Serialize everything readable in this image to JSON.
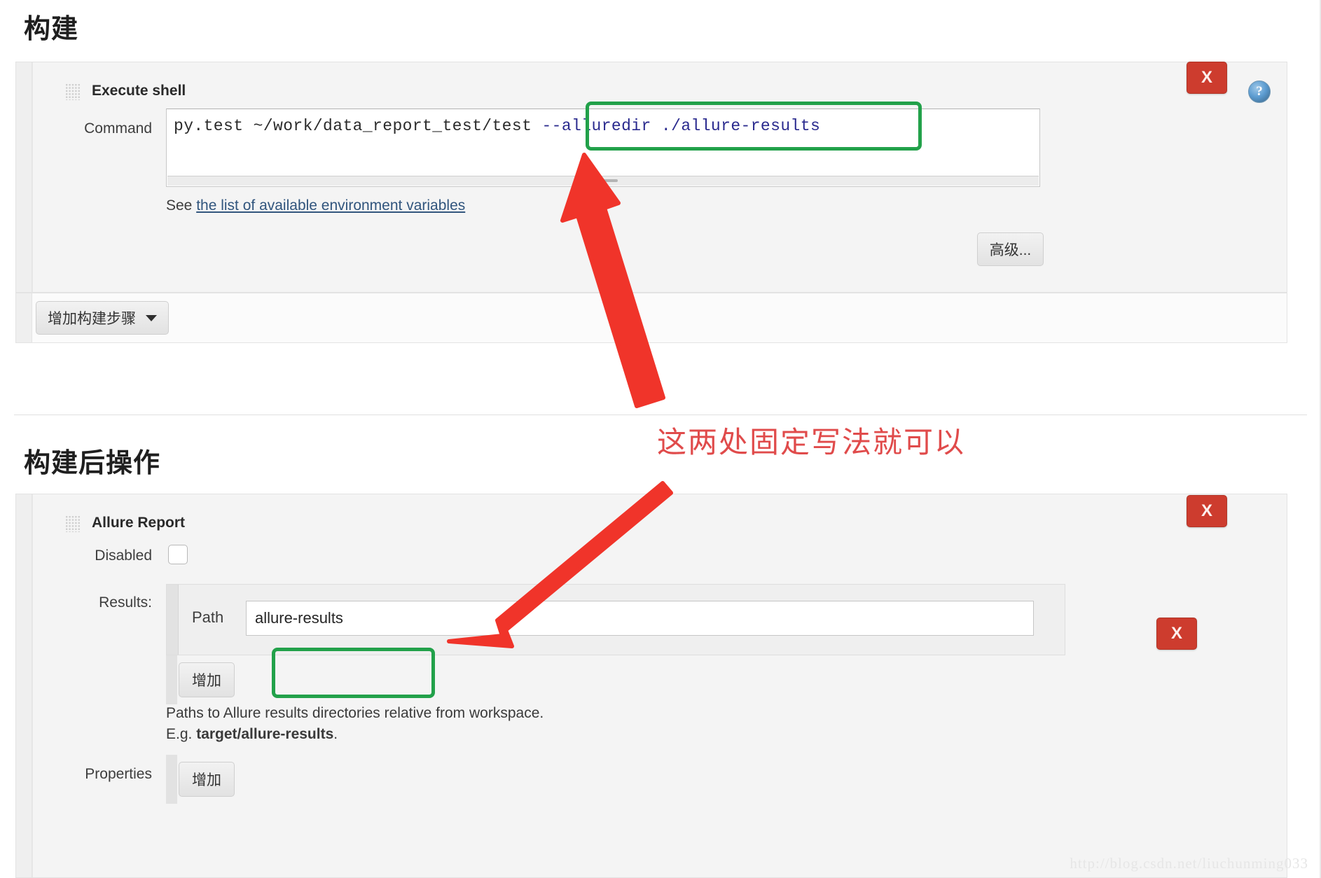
{
  "sections": {
    "build": {
      "heading": "构建"
    },
    "post_build": {
      "heading": "构建后操作"
    }
  },
  "execute_shell": {
    "title": "Execute shell",
    "command_label": "Command",
    "command_prefix": "py.test ~/work/data_report_test/test ",
    "command_highlight": "--alluredir ./allure-results",
    "command_full": "py.test ~/work/data_report_test/test --alluredir ./allure-results",
    "helper_prefix": "See ",
    "helper_link": "the list of available environment variables",
    "advanced_button": "高级...",
    "delete_button": "X",
    "help_icon": "?"
  },
  "add_build_step_button": "增加构建步骤",
  "allure_report": {
    "title": "Allure Report",
    "disabled_label": "Disabled",
    "disabled_checked": false,
    "results_label": "Results:",
    "path_label": "Path",
    "path_value": "allure-results",
    "results_add_button": "增加",
    "results_delete_button": "X",
    "delete_button": "X",
    "note_line1": "Paths to Allure results directories relative from workspace.",
    "note_line2_prefix": "E.g. ",
    "note_line2_bold": "target/allure-results",
    "note_line2_suffix": ".",
    "properties_label": "Properties",
    "properties_add_button": "增加"
  },
  "annotation": {
    "text": "这两处固定写法就可以",
    "color": "#e04b4b",
    "highlight_color": "#22a14a"
  },
  "watermark": "http://blog.csdn.net/liuchunming033"
}
